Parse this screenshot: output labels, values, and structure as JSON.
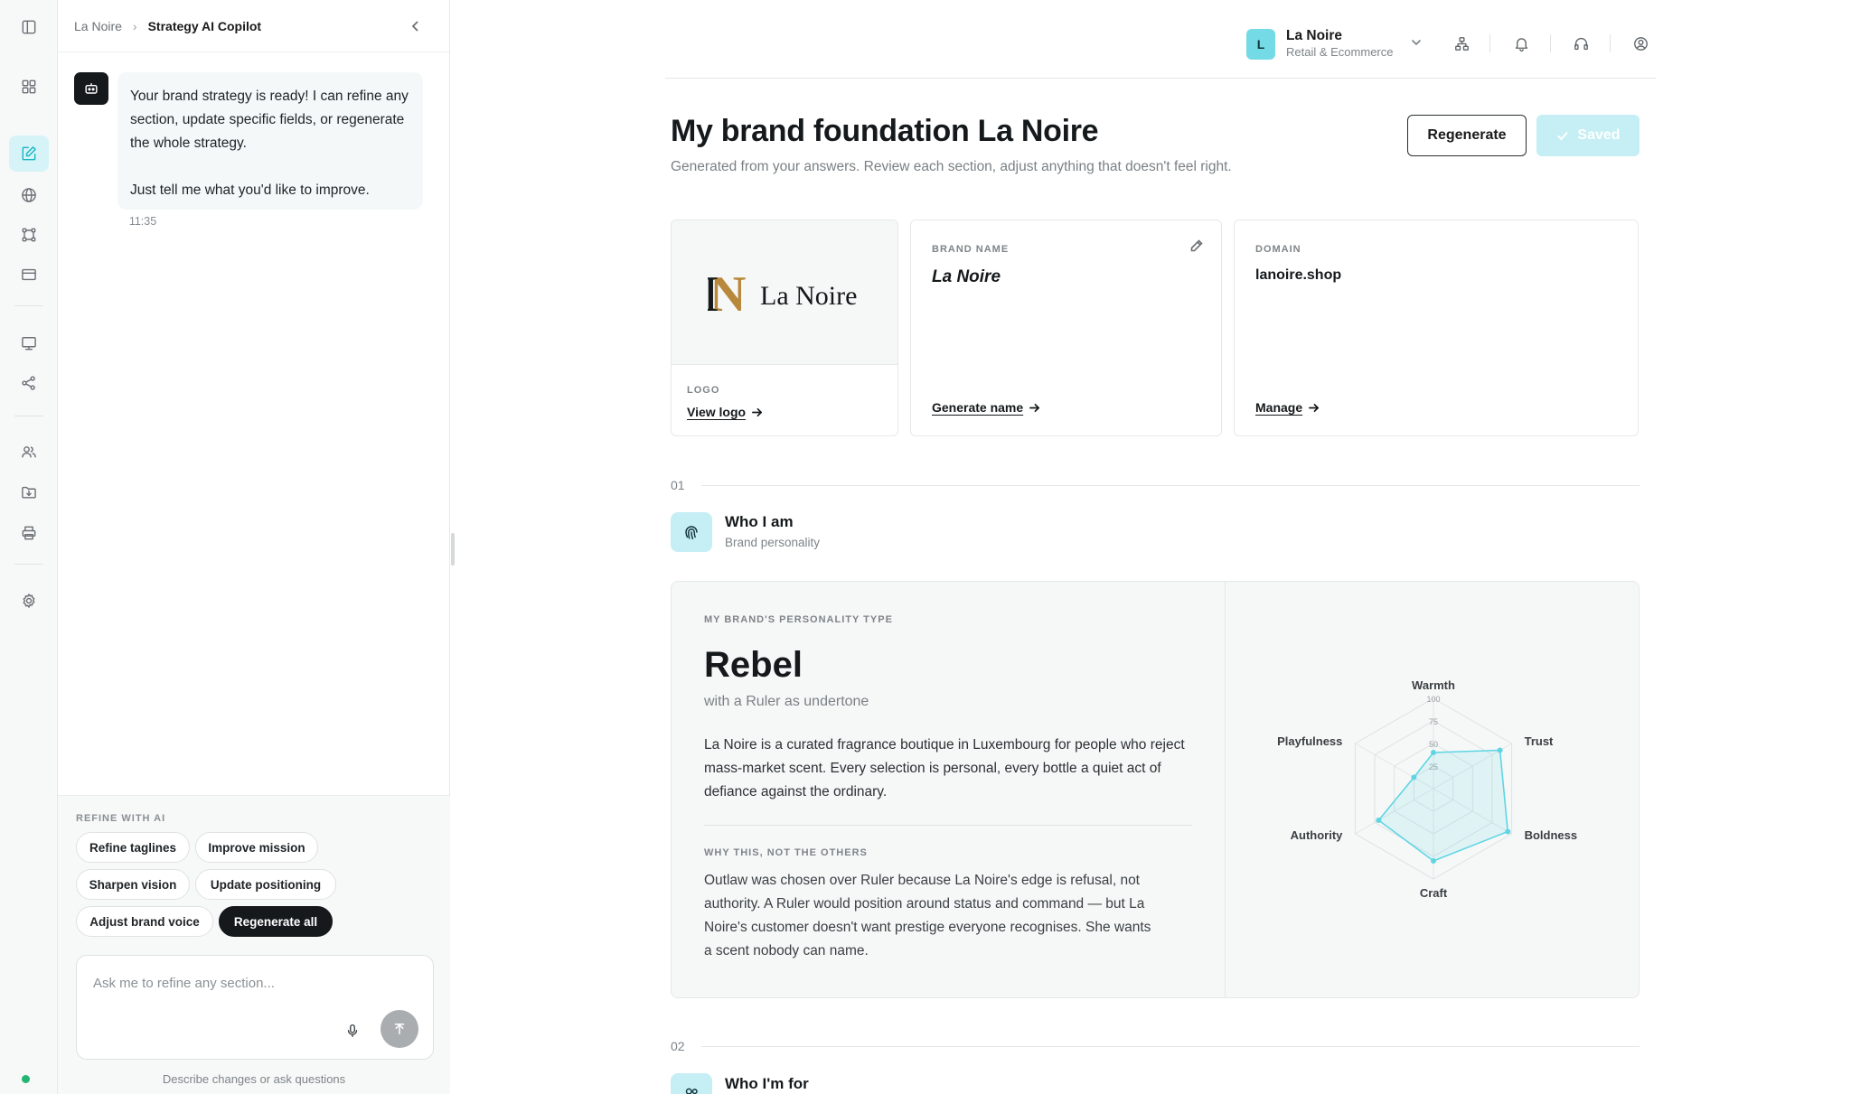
{
  "chat": {
    "breadcrumb": [
      "La Noire",
      "Strategy AI Copilot"
    ],
    "message": {
      "paragraphs": [
        "Your brand strategy is ready! I can refine any section, update specific fields, or regenerate the whole strategy.",
        "Just tell me what you'd like to improve."
      ],
      "time": "11:35"
    },
    "refine": {
      "label": "REFINE WITH AI",
      "chips": [
        "Refine taglines",
        "Improve mission",
        "Sharpen vision",
        "Update positioning",
        "Adjust brand voice",
        "Regenerate all"
      ],
      "input_placeholder": "Ask me to refine any section...",
      "hint": "Describe changes or ask questions"
    }
  },
  "topbar": {
    "account": {
      "initial": "L",
      "name": "La Noire",
      "subtitle": "Retail & Ecommerce"
    }
  },
  "main": {
    "title": "My brand foundation La Noire",
    "subtitle": "Generated from your answers. Review each section, adjust anything that doesn't feel right.",
    "buttons": {
      "regenerate": "Regenerate",
      "saved": "Saved"
    },
    "cards": {
      "logo": {
        "wordmark": "La Noire",
        "label": "LOGO",
        "link": "View logo"
      },
      "brand_name": {
        "label": "BRAND NAME",
        "value": "La Noire",
        "link": "Generate name"
      },
      "domain": {
        "label": "DOMAIN",
        "value": "lanoire.shop",
        "link": "Manage"
      }
    },
    "sections": [
      {
        "number": "01",
        "title": "Who I am",
        "subtitle": "Brand personality",
        "personality_label": "MY BRAND'S PERSONALITY TYPE",
        "personality_type": "Rebel",
        "undertone": "with a Ruler as undertone",
        "description": "La Noire is a curated fragrance boutique in Luxembourg for people who reject mass-market scent. Every selection is personal, every bottle a quiet act of defiance against the ordinary.",
        "why_label": "WHY THIS, NOT THE OTHERS",
        "why_text": "Outlaw was chosen over Ruler because La Noire's edge is refusal, not authority. A Ruler would position around status and command — but La Noire's customer doesn't want prestige everyone recognises. She wants a scent nobody can name."
      },
      {
        "number": "02",
        "title": "Who I'm for"
      }
    ]
  },
  "chart_data": {
    "type": "radar",
    "categories": [
      "Warmth",
      "Trust",
      "Boldness",
      "Craft",
      "Authority",
      "Playfulness"
    ],
    "values": [
      40,
      85,
      95,
      80,
      70,
      25
    ],
    "rlim": [
      0,
      100
    ],
    "ticks": [
      "25",
      "50",
      "75",
      "100"
    ],
    "color": "#5fd5e3"
  }
}
